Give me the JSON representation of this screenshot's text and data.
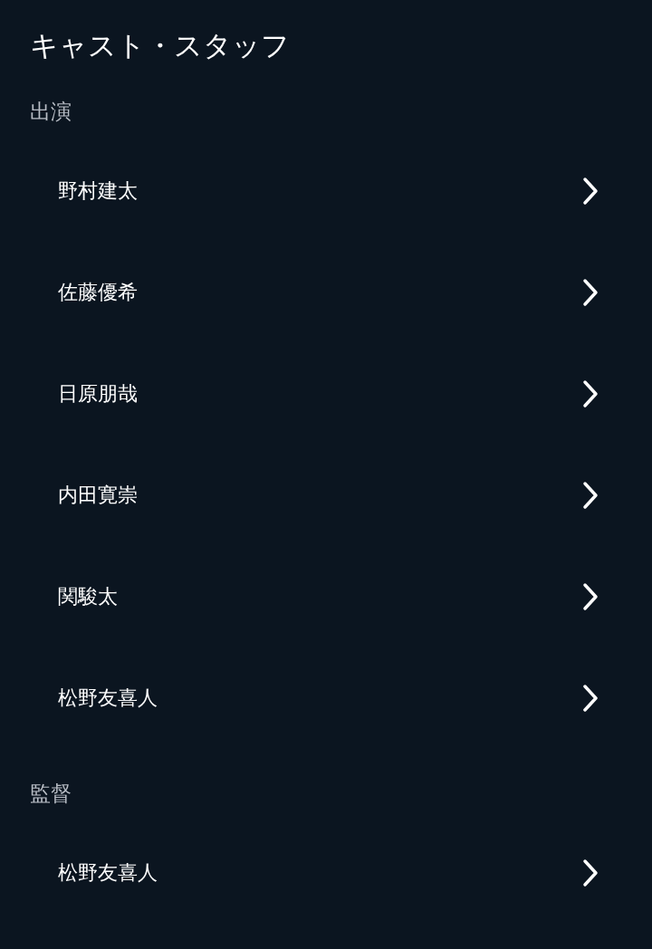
{
  "title": "キャスト・スタッフ",
  "sections": [
    {
      "heading": "出演",
      "people": [
        {
          "name": "野村建太"
        },
        {
          "name": "佐藤優希"
        },
        {
          "name": "日原朋哉"
        },
        {
          "name": "内田寛崇"
        },
        {
          "name": "関駿太"
        },
        {
          "name": "松野友喜人"
        }
      ]
    },
    {
      "heading": "監督",
      "people": [
        {
          "name": "松野友喜人"
        }
      ]
    }
  ]
}
